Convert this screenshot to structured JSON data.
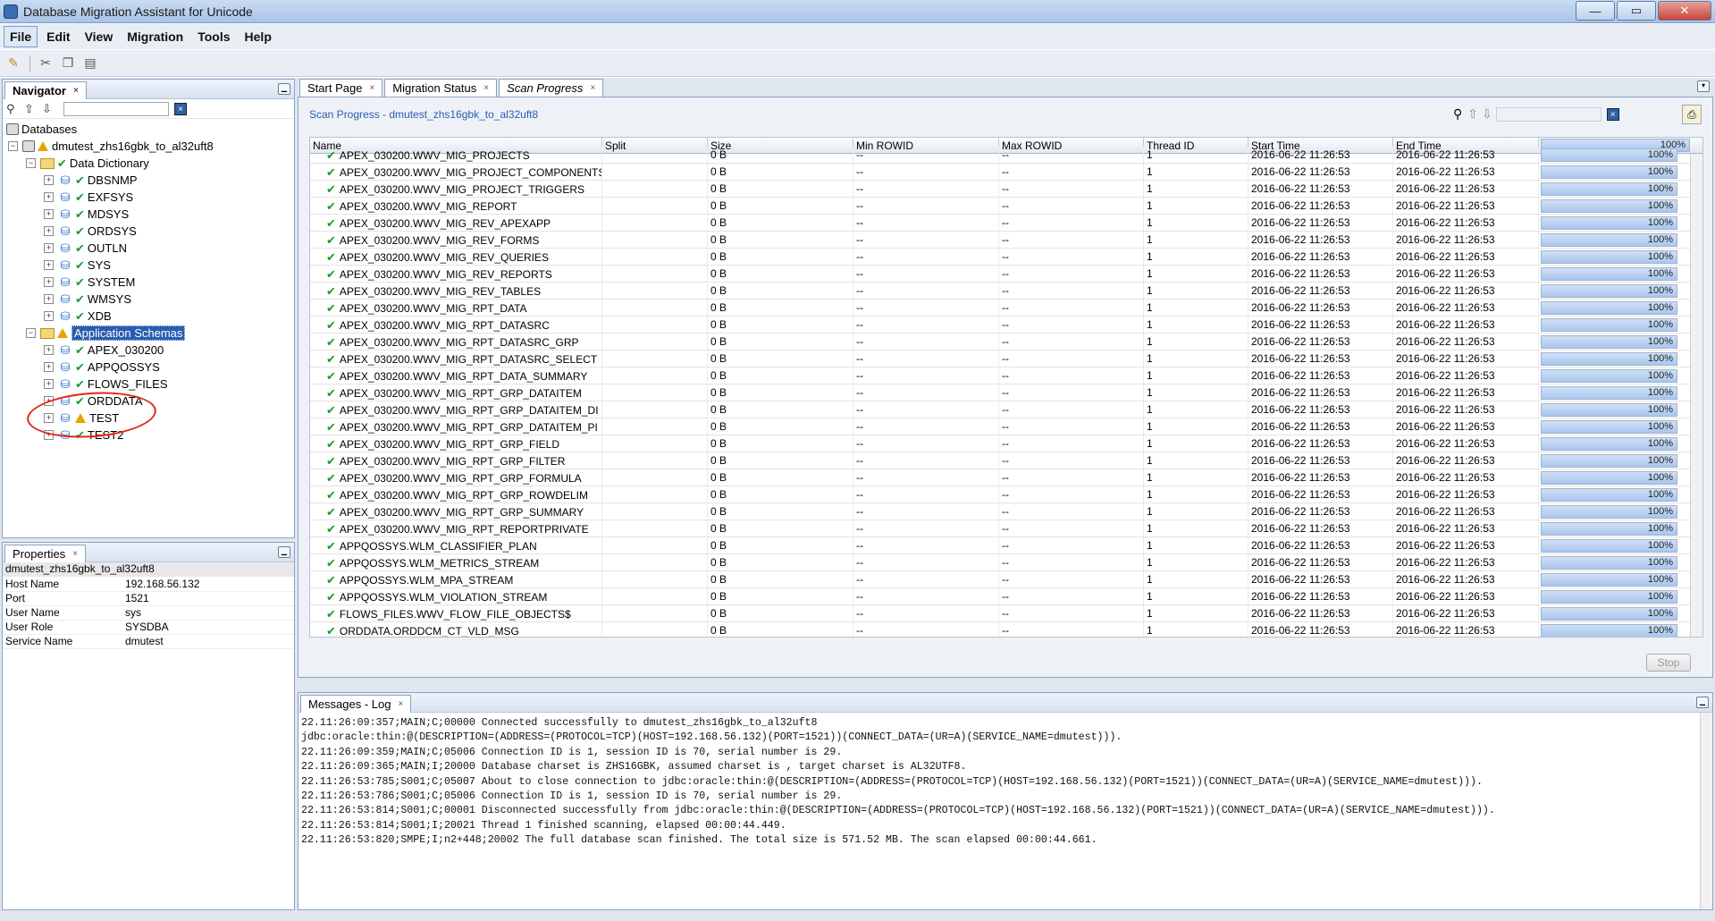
{
  "window": {
    "title": "Database Migration Assistant for Unicode",
    "min_label": "—",
    "max_label": "▭",
    "close_label": "✕"
  },
  "menu": [
    "File",
    "Edit",
    "View",
    "Migration",
    "Tools",
    "Help"
  ],
  "navigator": {
    "tab_label": "Navigator",
    "root_label": "Databases",
    "connection_label": "dmutest_zhs16gbk_to_al32uft8",
    "data_dictionary": {
      "label": "Data Dictionary",
      "schemas": [
        "DBSNMP",
        "EXFSYS",
        "MDSYS",
        "ORDSYS",
        "OUTLN",
        "SYS",
        "SYSTEM",
        "WMSYS",
        "XDB"
      ]
    },
    "application_schemas": {
      "label": "Application Schemas",
      "schemas": [
        {
          "name": "APEX_030200",
          "status": "ok"
        },
        {
          "name": "APPQOSSYS",
          "status": "ok"
        },
        {
          "name": "FLOWS_FILES",
          "status": "ok"
        },
        {
          "name": "ORDDATA",
          "status": "ok"
        },
        {
          "name": "TEST",
          "status": "warning"
        },
        {
          "name": "TEST2",
          "status": "ok"
        }
      ]
    }
  },
  "properties": {
    "tab_label": "Properties",
    "title": "dmutest_zhs16gbk_to_al32uft8",
    "rows": [
      {
        "key": "Host Name",
        "value": "192.168.56.132"
      },
      {
        "key": "Port",
        "value": "1521"
      },
      {
        "key": "User Name",
        "value": "sys"
      },
      {
        "key": "User Role",
        "value": "SYSDBA"
      },
      {
        "key": "Service Name",
        "value": "dmutest"
      }
    ]
  },
  "editor_tabs": [
    {
      "label": "Start Page",
      "active": false
    },
    {
      "label": "Migration Status",
      "active": false
    },
    {
      "label": "Scan Progress",
      "active": true
    }
  ],
  "scan": {
    "title": "Scan Progress - dmutest_zhs16gbk_to_al32uft8",
    "columns": [
      "Name",
      "Split",
      "Size",
      "Min ROWID",
      "Max ROWID",
      "Thread ID",
      "Start Time",
      "End Time"
    ],
    "header_progress_label": "100%",
    "header_progress": 1.0,
    "rows": [
      {
        "name": "APEX_030200.WWV_MIG_PROJECTS",
        "split": "",
        "size": "0 B",
        "min": "--",
        "max": "--",
        "thread": "1",
        "start": "2016-06-22 11:26:53",
        "end": "2016-06-22 11:26:53",
        "progress": 1.0,
        "label": "100%"
      },
      {
        "name": "APEX_030200.WWV_MIG_PROJECT_COMPONENTS",
        "split": "",
        "size": "0 B",
        "min": "--",
        "max": "--",
        "thread": "1",
        "start": "2016-06-22 11:26:53",
        "end": "2016-06-22 11:26:53",
        "progress": 1.0,
        "label": "100%"
      },
      {
        "name": "APEX_030200.WWV_MIG_PROJECT_TRIGGERS",
        "split": "",
        "size": "0 B",
        "min": "--",
        "max": "--",
        "thread": "1",
        "start": "2016-06-22 11:26:53",
        "end": "2016-06-22 11:26:53",
        "progress": 1.0,
        "label": "100%"
      },
      {
        "name": "APEX_030200.WWV_MIG_REPORT",
        "split": "",
        "size": "0 B",
        "min": "--",
        "max": "--",
        "thread": "1",
        "start": "2016-06-22 11:26:53",
        "end": "2016-06-22 11:26:53",
        "progress": 1.0,
        "label": "100%"
      },
      {
        "name": "APEX_030200.WWV_MIG_REV_APEXAPP",
        "split": "",
        "size": "0 B",
        "min": "--",
        "max": "--",
        "thread": "1",
        "start": "2016-06-22 11:26:53",
        "end": "2016-06-22 11:26:53",
        "progress": 1.0,
        "label": "100%"
      },
      {
        "name": "APEX_030200.WWV_MIG_REV_FORMS",
        "split": "",
        "size": "0 B",
        "min": "--",
        "max": "--",
        "thread": "1",
        "start": "2016-06-22 11:26:53",
        "end": "2016-06-22 11:26:53",
        "progress": 1.0,
        "label": "100%"
      },
      {
        "name": "APEX_030200.WWV_MIG_REV_QUERIES",
        "split": "",
        "size": "0 B",
        "min": "--",
        "max": "--",
        "thread": "1",
        "start": "2016-06-22 11:26:53",
        "end": "2016-06-22 11:26:53",
        "progress": 1.0,
        "label": "100%"
      },
      {
        "name": "APEX_030200.WWV_MIG_REV_REPORTS",
        "split": "",
        "size": "0 B",
        "min": "--",
        "max": "--",
        "thread": "1",
        "start": "2016-06-22 11:26:53",
        "end": "2016-06-22 11:26:53",
        "progress": 1.0,
        "label": "100%"
      },
      {
        "name": "APEX_030200.WWV_MIG_REV_TABLES",
        "split": "",
        "size": "0 B",
        "min": "--",
        "max": "--",
        "thread": "1",
        "start": "2016-06-22 11:26:53",
        "end": "2016-06-22 11:26:53",
        "progress": 1.0,
        "label": "100%"
      },
      {
        "name": "APEX_030200.WWV_MIG_RPT_DATA",
        "split": "",
        "size": "0 B",
        "min": "--",
        "max": "--",
        "thread": "1",
        "start": "2016-06-22 11:26:53",
        "end": "2016-06-22 11:26:53",
        "progress": 1.0,
        "label": "100%"
      },
      {
        "name": "APEX_030200.WWV_MIG_RPT_DATASRC",
        "split": "",
        "size": "0 B",
        "min": "--",
        "max": "--",
        "thread": "1",
        "start": "2016-06-22 11:26:53",
        "end": "2016-06-22 11:26:53",
        "progress": 1.0,
        "label": "100%"
      },
      {
        "name": "APEX_030200.WWV_MIG_RPT_DATASRC_GRP",
        "split": "",
        "size": "0 B",
        "min": "--",
        "max": "--",
        "thread": "1",
        "start": "2016-06-22 11:26:53",
        "end": "2016-06-22 11:26:53",
        "progress": 1.0,
        "label": "100%"
      },
      {
        "name": "APEX_030200.WWV_MIG_RPT_DATASRC_SELECT",
        "split": "",
        "size": "0 B",
        "min": "--",
        "max": "--",
        "thread": "1",
        "start": "2016-06-22 11:26:53",
        "end": "2016-06-22 11:26:53",
        "progress": 1.0,
        "label": "100%"
      },
      {
        "name": "APEX_030200.WWV_MIG_RPT_DATA_SUMMARY",
        "split": "",
        "size": "0 B",
        "min": "--",
        "max": "--",
        "thread": "1",
        "start": "2016-06-22 11:26:53",
        "end": "2016-06-22 11:26:53",
        "progress": 1.0,
        "label": "100%"
      },
      {
        "name": "APEX_030200.WWV_MIG_RPT_GRP_DATAITEM",
        "split": "",
        "size": "0 B",
        "min": "--",
        "max": "--",
        "thread": "1",
        "start": "2016-06-22 11:26:53",
        "end": "2016-06-22 11:26:53",
        "progress": 1.0,
        "label": "100%"
      },
      {
        "name": "APEX_030200.WWV_MIG_RPT_GRP_DATAITEM_DI",
        "split": "",
        "size": "0 B",
        "min": "--",
        "max": "--",
        "thread": "1",
        "start": "2016-06-22 11:26:53",
        "end": "2016-06-22 11:26:53",
        "progress": 1.0,
        "label": "100%"
      },
      {
        "name": "APEX_030200.WWV_MIG_RPT_GRP_DATAITEM_PI",
        "split": "",
        "size": "0 B",
        "min": "--",
        "max": "--",
        "thread": "1",
        "start": "2016-06-22 11:26:53",
        "end": "2016-06-22 11:26:53",
        "progress": 1.0,
        "label": "100%"
      },
      {
        "name": "APEX_030200.WWV_MIG_RPT_GRP_FIELD",
        "split": "",
        "size": "0 B",
        "min": "--",
        "max": "--",
        "thread": "1",
        "start": "2016-06-22 11:26:53",
        "end": "2016-06-22 11:26:53",
        "progress": 1.0,
        "label": "100%"
      },
      {
        "name": "APEX_030200.WWV_MIG_RPT_GRP_FILTER",
        "split": "",
        "size": "0 B",
        "min": "--",
        "max": "--",
        "thread": "1",
        "start": "2016-06-22 11:26:53",
        "end": "2016-06-22 11:26:53",
        "progress": 1.0,
        "label": "100%"
      },
      {
        "name": "APEX_030200.WWV_MIG_RPT_GRP_FORMULA",
        "split": "",
        "size": "0 B",
        "min": "--",
        "max": "--",
        "thread": "1",
        "start": "2016-06-22 11:26:53",
        "end": "2016-06-22 11:26:53",
        "progress": 1.0,
        "label": "100%"
      },
      {
        "name": "APEX_030200.WWV_MIG_RPT_GRP_ROWDELIM",
        "split": "",
        "size": "0 B",
        "min": "--",
        "max": "--",
        "thread": "1",
        "start": "2016-06-22 11:26:53",
        "end": "2016-06-22 11:26:53",
        "progress": 1.0,
        "label": "100%"
      },
      {
        "name": "APEX_030200.WWV_MIG_RPT_GRP_SUMMARY",
        "split": "",
        "size": "0 B",
        "min": "--",
        "max": "--",
        "thread": "1",
        "start": "2016-06-22 11:26:53",
        "end": "2016-06-22 11:26:53",
        "progress": 1.0,
        "label": "100%"
      },
      {
        "name": "APEX_030200.WWV_MIG_RPT_REPORTPRIVATE",
        "split": "",
        "size": "0 B",
        "min": "--",
        "max": "--",
        "thread": "1",
        "start": "2016-06-22 11:26:53",
        "end": "2016-06-22 11:26:53",
        "progress": 1.0,
        "label": "100%"
      },
      {
        "name": "APPQOSSYS.WLM_CLASSIFIER_PLAN",
        "split": "",
        "size": "0 B",
        "min": "--",
        "max": "--",
        "thread": "1",
        "start": "2016-06-22 11:26:53",
        "end": "2016-06-22 11:26:53",
        "progress": 1.0,
        "label": "100%"
      },
      {
        "name": "APPQOSSYS.WLM_METRICS_STREAM",
        "split": "",
        "size": "0 B",
        "min": "--",
        "max": "--",
        "thread": "1",
        "start": "2016-06-22 11:26:53",
        "end": "2016-06-22 11:26:53",
        "progress": 1.0,
        "label": "100%"
      },
      {
        "name": "APPQOSSYS.WLM_MPA_STREAM",
        "split": "",
        "size": "0 B",
        "min": "--",
        "max": "--",
        "thread": "1",
        "start": "2016-06-22 11:26:53",
        "end": "2016-06-22 11:26:53",
        "progress": 1.0,
        "label": "100%"
      },
      {
        "name": "APPQOSSYS.WLM_VIOLATION_STREAM",
        "split": "",
        "size": "0 B",
        "min": "--",
        "max": "--",
        "thread": "1",
        "start": "2016-06-22 11:26:53",
        "end": "2016-06-22 11:26:53",
        "progress": 1.0,
        "label": "100%"
      },
      {
        "name": "FLOWS_FILES.WWV_FLOW_FILE_OBJECTS$",
        "split": "",
        "size": "0 B",
        "min": "--",
        "max": "--",
        "thread": "1",
        "start": "2016-06-22 11:26:53",
        "end": "2016-06-22 11:26:53",
        "progress": 1.0,
        "label": "100%"
      },
      {
        "name": "ORDDATA.ORDDCM_CT_VLD_MSG",
        "split": "",
        "size": "0 B",
        "min": "--",
        "max": "--",
        "thread": "1",
        "start": "2016-06-22 11:26:53",
        "end": "2016-06-22 11:26:53",
        "progress": 1.0,
        "label": "100%"
      }
    ],
    "stop_label": "Stop"
  },
  "log": {
    "tab_label": "Messages - Log",
    "lines": [
      "22.11:26:09:357;MAIN;C;00000 Connected successfully to dmutest_zhs16gbk_to_al32uft8",
      "jdbc:oracle:thin:@(DESCRIPTION=(ADDRESS=(PROTOCOL=TCP)(HOST=192.168.56.132)(PORT=1521))(CONNECT_DATA=(UR=A)(SERVICE_NAME=dmutest))).",
      "22.11:26:09:359;MAIN;C;05006 Connection ID is 1, session ID is 70, serial number is 29.",
      "22.11:26:09:365;MAIN;I;20000 Database charset is ZHS16GBK, assumed charset is , target charset is AL32UTF8.",
      "22.11:26:53:785;S001;C;05007 About to close connection to jdbc:oracle:thin:@(DESCRIPTION=(ADDRESS=(PROTOCOL=TCP)(HOST=192.168.56.132)(PORT=1521))(CONNECT_DATA=(UR=A)(SERVICE_NAME=dmutest))).",
      "22.11:26:53:786;S001;C;05006 Connection ID is 1, session ID is 70, serial number is 29.",
      "22.11:26:53:814;S001;C;00001 Disconnected successfully from jdbc:oracle:thin:@(DESCRIPTION=(ADDRESS=(PROTOCOL=TCP)(HOST=192.168.56.132)(PORT=1521))(CONNECT_DATA=(UR=A)(SERVICE_NAME=dmutest))).",
      "22.11:26:53:814;S001;I;20021 Thread 1 finished scanning, elapsed  00:00:44.449.",
      "22.11:26:53:820;SMPE;I;n2+448;20002 The full database scan finished. The total size is 571.52 MB. The scan elapsed 00:00:44.661."
    ]
  },
  "icons": {
    "ok": "✔",
    "expand": "+",
    "collapse": "−",
    "close": "×",
    "binoculars": "⚲",
    "up": "⇧",
    "down": "⇩"
  },
  "colors": {
    "selection": "#2a5db0",
    "ok": "#1a9d2c",
    "warning": "#e6a400",
    "annotation": "#e1261c",
    "title_link": "#2a5db0"
  }
}
